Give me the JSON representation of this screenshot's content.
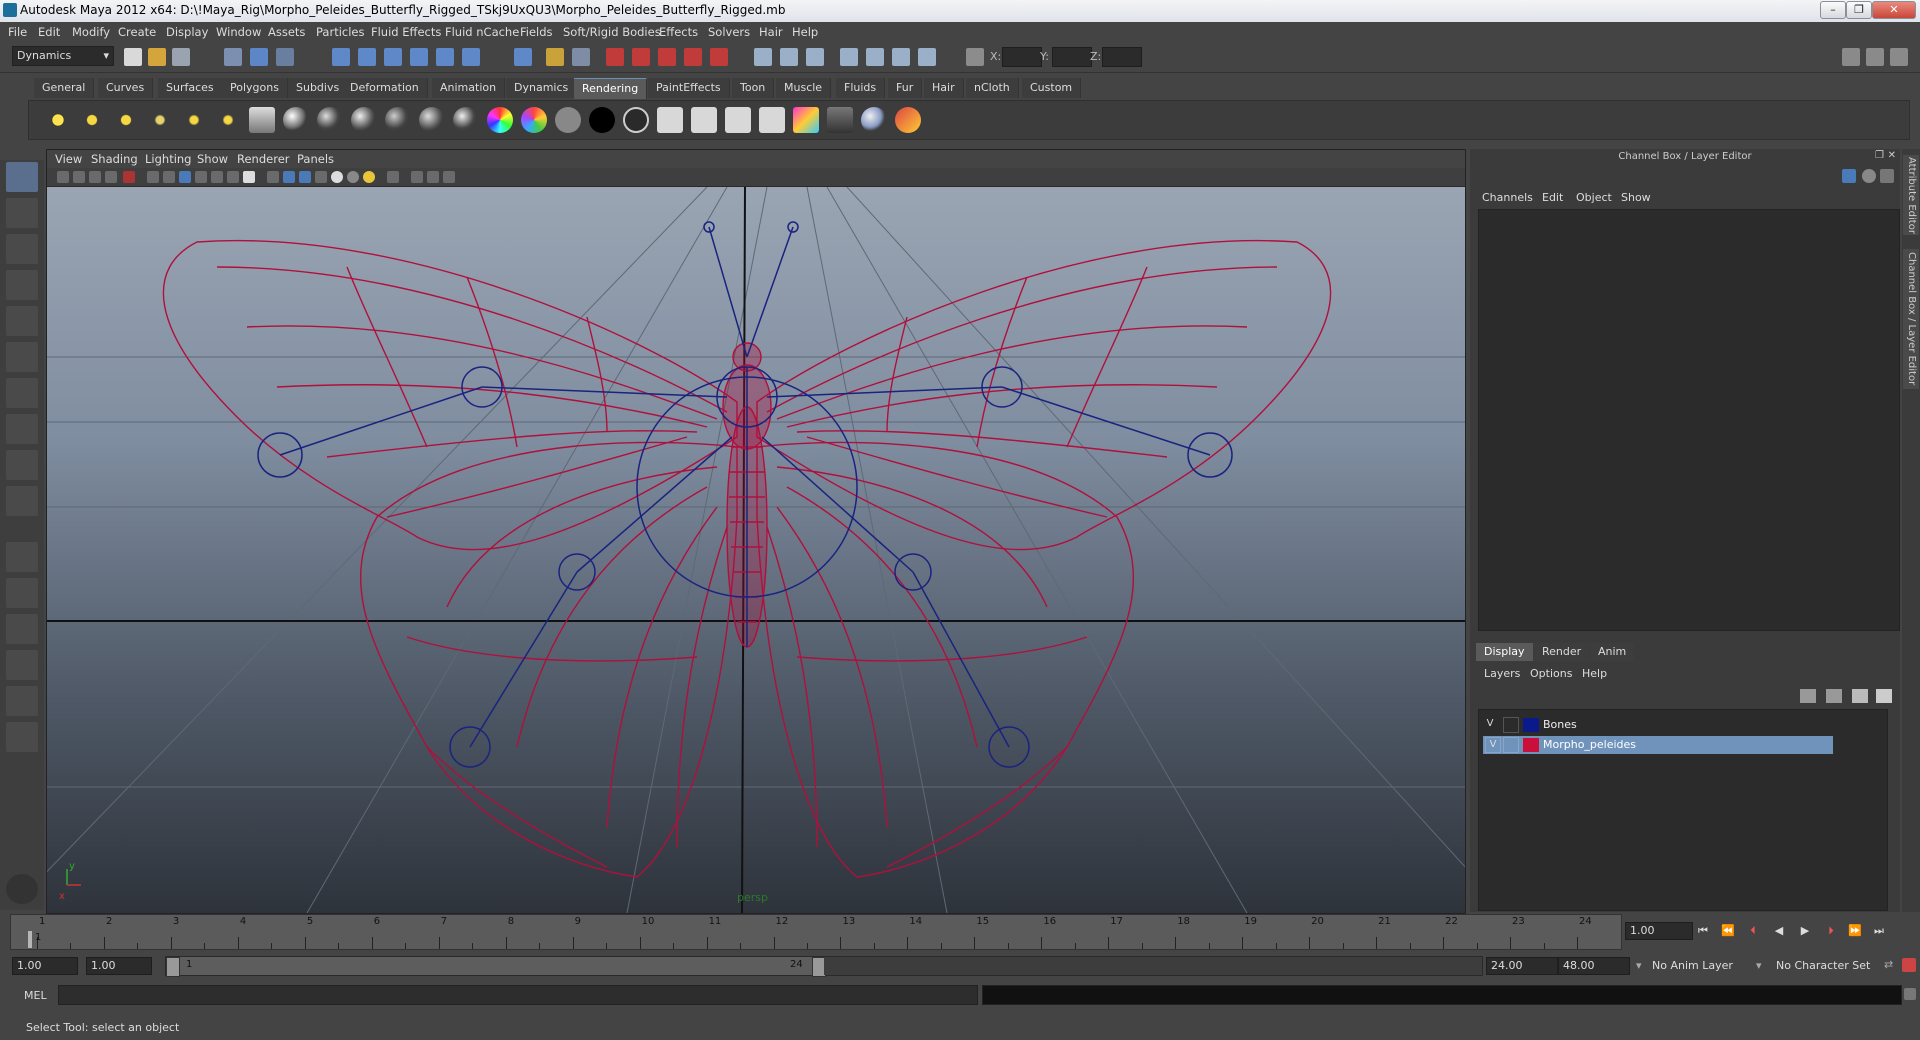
{
  "window": {
    "title": "Autodesk Maya 2012 x64: D:\\!Maya_Rig\\Morpho_Peleides_Butterfly_Rigged_TSkj9UxQU3\\Morpho_Peleides_Butterfly_Rigged.mb",
    "controls": [
      "–",
      "❐",
      "✕"
    ]
  },
  "menubar": [
    "File",
    "Edit",
    "Modify",
    "Create",
    "Display",
    "Window",
    "Assets",
    "Particles",
    "Fluid Effects",
    "Fluid nCache",
    "Fields",
    "Soft/Rigid Bodies",
    "Effects",
    "Solvers",
    "Hair",
    "Help"
  ],
  "statusline": {
    "menu_set": "Dynamics",
    "x_label": "X:",
    "y_label": "Y:",
    "z_label": "Z:"
  },
  "shelf": {
    "tabs": [
      "General",
      "Curves",
      "Surfaces",
      "Polygons",
      "Subdivs",
      "Deformation",
      "Animation",
      "Dynamics",
      "Rendering",
      "PaintEffects",
      "Toon",
      "Muscle",
      "Fluids",
      "Fur",
      "Hair",
      "nCloth",
      "Custom"
    ],
    "active_tab": "Rendering"
  },
  "viewport": {
    "menus": [
      "View",
      "Shading",
      "Lighting",
      "Show",
      "Renderer",
      "Panels"
    ],
    "camera_label": "persp",
    "axis_x": "x",
    "axis_y": "y",
    "wireframe_color": "#b0103c",
    "bones_color": "#1a237e"
  },
  "channel_box": {
    "title": "Channel Box / Layer Editor",
    "menus": [
      "Channels",
      "Edit",
      "Object",
      "Show"
    ]
  },
  "layer_editor": {
    "tabs": [
      "Display",
      "Render",
      "Anim"
    ],
    "active_tab": "Display",
    "menus": [
      "Layers",
      "Options",
      "Help"
    ],
    "layers": [
      {
        "visible": "V",
        "name": "Bones",
        "color": "#0b1a8a",
        "selected": false
      },
      {
        "visible": "V",
        "name": "Morpho_peleides",
        "color": "#c8103a",
        "selected": true
      }
    ]
  },
  "side_tabs": [
    "Attribute Editor",
    "Channel Box / Layer Editor"
  ],
  "timeline": {
    "frames": [
      "1",
      "2",
      "3",
      "4",
      "5",
      "6",
      "7",
      "8",
      "9",
      "10",
      "11",
      "12",
      "13",
      "14",
      "15",
      "16",
      "17",
      "18",
      "19",
      "20",
      "21",
      "22",
      "23",
      "24"
    ],
    "current_frame_marker": "1",
    "current_time": "1.00"
  },
  "range": {
    "start_time": "1.00",
    "playback_start": "1.00",
    "slider_start": "1",
    "slider_end": "24",
    "playback_end": "24.00",
    "end_time": "48.00",
    "anim_layer": "No Anim Layer",
    "character_set": "No Character Set"
  },
  "command_line": {
    "label": "MEL"
  },
  "help_line": {
    "text": "Select Tool: select an object"
  }
}
